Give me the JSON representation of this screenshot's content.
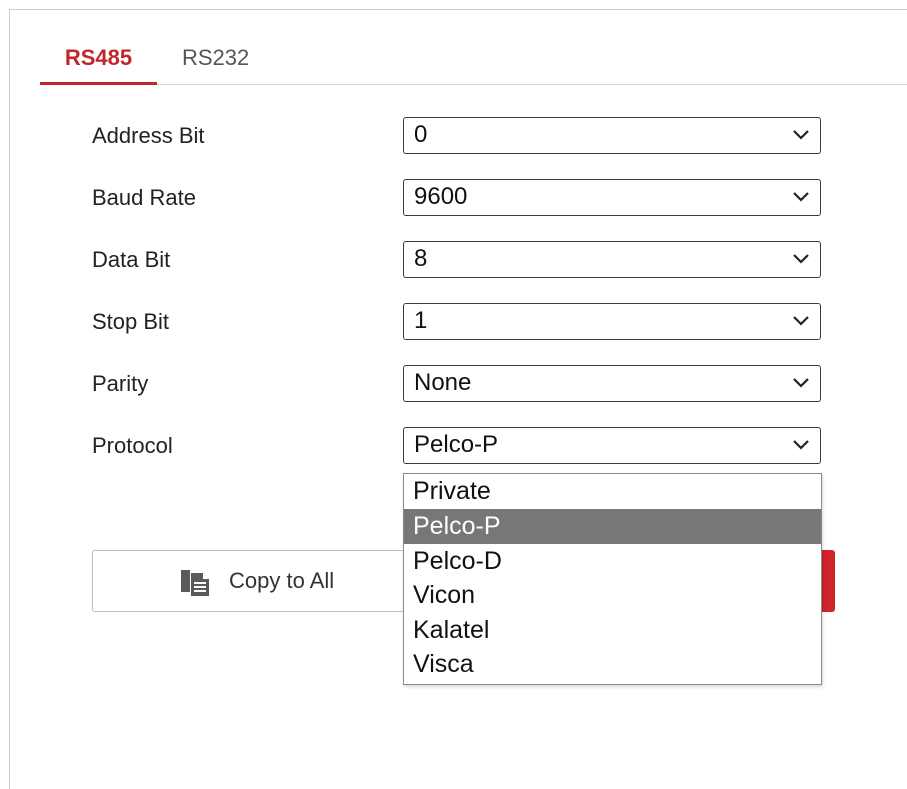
{
  "tabs": [
    {
      "label": "RS485",
      "active": true
    },
    {
      "label": "RS232",
      "active": false
    }
  ],
  "fields": [
    {
      "label": "Address Bit",
      "value": "0"
    },
    {
      "label": "Baud Rate",
      "value": "9600"
    },
    {
      "label": "Data Bit",
      "value": "8"
    },
    {
      "label": "Stop Bit",
      "value": "1"
    },
    {
      "label": "Parity",
      "value": "None"
    },
    {
      "label": "Protocol",
      "value": "Pelco-P"
    }
  ],
  "protocol_dropdown": {
    "options": [
      "Private",
      "Pelco-P",
      "Pelco-D",
      "Vicon",
      "Kalatel",
      "Visca"
    ],
    "selected": "Pelco-P"
  },
  "buttons": {
    "copy_to_all": "Copy to All"
  },
  "colors": {
    "accent": "#c4262e",
    "button_red": "#d0232c",
    "option_highlight": "#777777"
  },
  "icons": {
    "copy": "copy-icon",
    "chevron": "chevron-down-icon"
  }
}
